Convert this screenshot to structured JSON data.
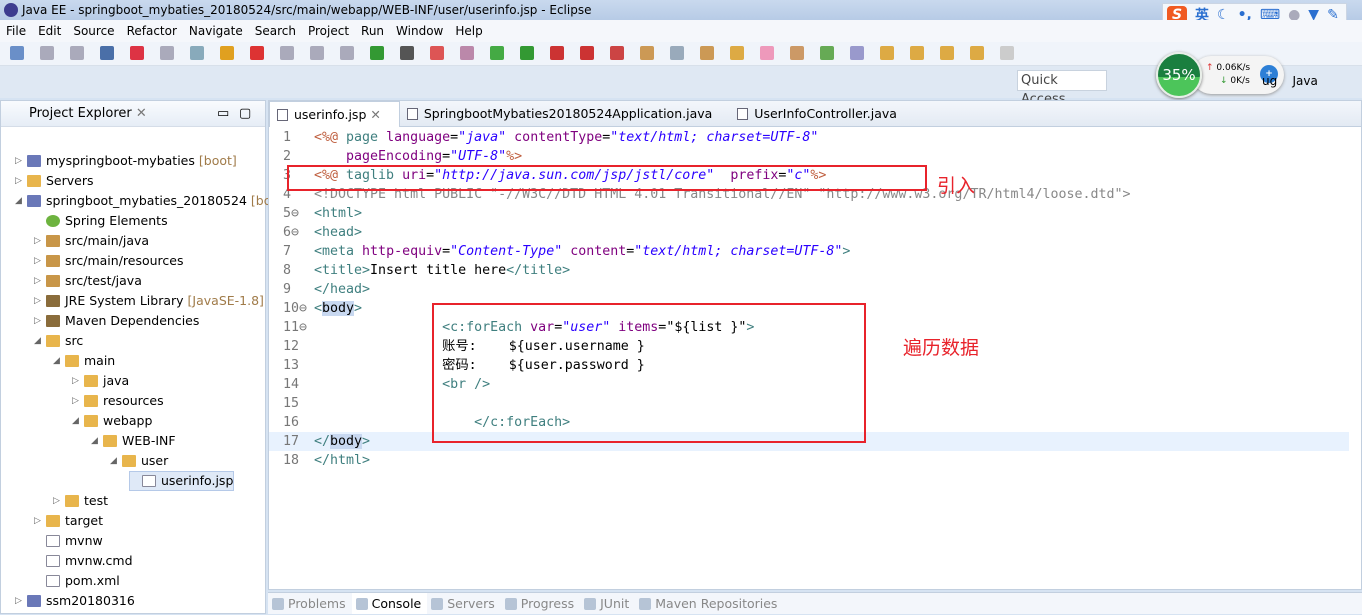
{
  "window": {
    "title": "Java EE - springboot_mybaties_20180524/src/main/webapp/WEB-INF/user/userinfo.jsp - Eclipse"
  },
  "ime": {
    "logo": "S",
    "lang": "英"
  },
  "menu": [
    "File",
    "Edit",
    "Source",
    "Refactor",
    "Navigate",
    "Search",
    "Project",
    "Run",
    "Window",
    "Help"
  ],
  "quick_access": {
    "placeholder": "Quick Access"
  },
  "speed": {
    "percent": "35%",
    "up": "0.06K/s",
    "down": "0K/s"
  },
  "perspectives": [
    "ug",
    "Java"
  ],
  "explorer": {
    "title": "Project Explorer",
    "tree": [
      {
        "label": "myspringboot-mybaties",
        "deco": "[boot]",
        "depth": 0,
        "arrow": "▷",
        "icon": "proj"
      },
      {
        "label": "Servers",
        "depth": 0,
        "arrow": "▷",
        "icon": "folder"
      },
      {
        "label": "springboot_mybaties_20180524",
        "deco": "[boo",
        "depth": 0,
        "arrow": "◢",
        "icon": "proj"
      },
      {
        "label": "Spring Elements",
        "depth": 1,
        "arrow": "",
        "icon": "spring"
      },
      {
        "label": "src/main/java",
        "depth": 1,
        "arrow": "▷",
        "icon": "pkg"
      },
      {
        "label": "src/main/resources",
        "depth": 1,
        "arrow": "▷",
        "icon": "pkg"
      },
      {
        "label": "src/test/java",
        "depth": 1,
        "arrow": "▷",
        "icon": "pkg"
      },
      {
        "label": "JRE System Library",
        "deco": "[JavaSE-1.8]",
        "depth": 1,
        "arrow": "▷",
        "icon": "lib"
      },
      {
        "label": "Maven Dependencies",
        "depth": 1,
        "arrow": "▷",
        "icon": "lib"
      },
      {
        "label": "src",
        "depth": 1,
        "arrow": "◢",
        "icon": "folder"
      },
      {
        "label": "main",
        "depth": 2,
        "arrow": "◢",
        "icon": "folder"
      },
      {
        "label": "java",
        "depth": 3,
        "arrow": "▷",
        "icon": "folder"
      },
      {
        "label": "resources",
        "depth": 3,
        "arrow": "▷",
        "icon": "folder"
      },
      {
        "label": "webapp",
        "depth": 3,
        "arrow": "◢",
        "icon": "folder"
      },
      {
        "label": "WEB-INF",
        "depth": 4,
        "arrow": "◢",
        "icon": "folder"
      },
      {
        "label": "user",
        "depth": 5,
        "arrow": "◢",
        "icon": "folder"
      },
      {
        "label": "userinfo.jsp",
        "depth": 6,
        "arrow": "",
        "icon": "file",
        "selected": true
      },
      {
        "label": "test",
        "depth": 2,
        "arrow": "▷",
        "icon": "folder"
      },
      {
        "label": "target",
        "depth": 1,
        "arrow": "▷",
        "icon": "folder"
      },
      {
        "label": "mvnw",
        "depth": 1,
        "arrow": "",
        "icon": "file"
      },
      {
        "label": "mvnw.cmd",
        "depth": 1,
        "arrow": "",
        "icon": "file"
      },
      {
        "label": "pom.xml",
        "depth": 1,
        "arrow": "",
        "icon": "file"
      },
      {
        "label": "ssm20180316",
        "depth": 0,
        "arrow": "▷",
        "icon": "proj"
      }
    ]
  },
  "editor": {
    "tabs": [
      "userinfo.jsp",
      "SpringbootMybaties20180524Application.java",
      "UserInfoController.java"
    ],
    "lines": [
      [
        [
          "<%@ ",
          "d"
        ],
        [
          "page ",
          "t"
        ],
        [
          "language",
          "a"
        ],
        [
          "=",
          "x"
        ],
        [
          "\"java\"",
          "s"
        ],
        [
          " contentType",
          "a"
        ],
        [
          "=",
          "x"
        ],
        [
          "\"text/html; charset=UTF-8\"",
          "s"
        ]
      ],
      [
        [
          "    pageEncoding",
          "a"
        ],
        [
          "=",
          "x"
        ],
        [
          "\"UTF-8\"",
          "s"
        ],
        [
          "%>",
          "d"
        ]
      ],
      [
        [
          "<%@ ",
          "d"
        ],
        [
          "taglib ",
          "t"
        ],
        [
          "uri",
          "a"
        ],
        [
          "=",
          "x"
        ],
        [
          "\"http://java.sun.com/jsp/jstl/core\"",
          "s"
        ],
        [
          "  prefix",
          "a"
        ],
        [
          "=",
          "x"
        ],
        [
          "\"c\"",
          "s"
        ],
        [
          "%>",
          "d"
        ]
      ],
      [
        [
          "<!DOCTYPE html PUBLIC \"-//W3C//DTD HTML 4.01 Transitional//EN\" \"http://www.w3.org/TR/html4/loose.dtd\">",
          "g"
        ]
      ],
      [
        [
          "<html>",
          "t"
        ]
      ],
      [
        [
          "<head>",
          "t"
        ]
      ],
      [
        [
          "<meta ",
          "t"
        ],
        [
          "http-equiv",
          "a"
        ],
        [
          "=",
          "x"
        ],
        [
          "\"Content-Type\"",
          "s"
        ],
        [
          " content",
          "a"
        ],
        [
          "=",
          "x"
        ],
        [
          "\"text/html; charset=UTF-8\"",
          "s"
        ],
        [
          ">",
          "t"
        ]
      ],
      [
        [
          "<title>",
          "t"
        ],
        [
          "Insert title here",
          "x"
        ],
        [
          "</title>",
          "t"
        ]
      ],
      [
        [
          "</head>",
          "t"
        ]
      ],
      [
        [
          "<",
          "t"
        ],
        [
          "body",
          "sel"
        ],
        [
          ">",
          "t"
        ]
      ],
      [
        [
          "                <c:forEach ",
          "t"
        ],
        [
          "var",
          "a"
        ],
        [
          "=",
          "x"
        ],
        [
          "\"user\"",
          "s"
        ],
        [
          " items",
          "a"
        ],
        [
          "=",
          "x"
        ],
        [
          "\"${list }\"",
          "x"
        ],
        [
          ">",
          "t"
        ]
      ],
      [
        [
          "                账号:    ${user.username }",
          "x"
        ]
      ],
      [
        [
          "                密码:    ${user.password }",
          "x"
        ]
      ],
      [
        [
          "                <br />",
          "t"
        ]
      ],
      [
        [
          "",
          "x"
        ]
      ],
      [
        [
          "                    </c:forEach>",
          "t"
        ]
      ],
      [
        [
          "</",
          "t"
        ],
        [
          "body",
          "sel"
        ],
        [
          ">",
          "t"
        ]
      ],
      [
        [
          "</html>",
          "t"
        ]
      ]
    ]
  },
  "annotations": {
    "import": "引入",
    "iterate": "遍历数据"
  },
  "bottom_tabs": [
    "Problems",
    "Console",
    "Servers",
    "Progress",
    "JUnit",
    "Maven Repositories"
  ]
}
